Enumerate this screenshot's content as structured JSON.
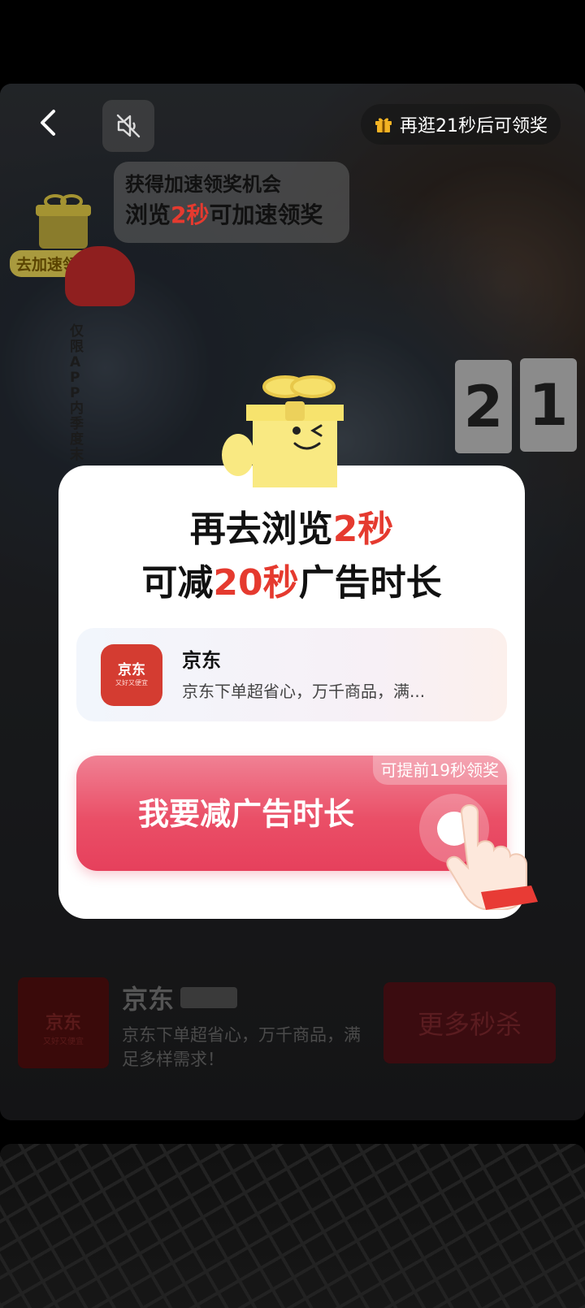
{
  "top_bar": {
    "timer_text": "再逛21秒后可领奖"
  },
  "speed_badge": {
    "label": "去加速领奖"
  },
  "speed_bubble": {
    "line1": "获得加速领奖机会",
    "line2_prefix": "浏览",
    "line2_highlight": "2秒",
    "line2_suffix": "可加速领奖"
  },
  "background_text": {
    "vertical_note": "仅限APP内季度末",
    "date_digits": [
      "2",
      "1"
    ]
  },
  "modal": {
    "title_line1_prefix": "再去浏览",
    "title_line1_highlight": "2秒",
    "title_line2_prefix": "可减",
    "title_line2_highlight": "20秒",
    "title_line2_suffix": "广告时长",
    "app": {
      "icon_logo": "京东",
      "icon_slogan": "又好又便宜",
      "name": "京东",
      "description": "京东下单超省心，万千商品，满..."
    },
    "cta_chip": "可提前19秒领奖",
    "cta_label": "我要减广告时长"
  },
  "bottom_ad": {
    "logo_text": "京东",
    "logo_slogan": "又好又便宜",
    "name": "京东",
    "description": "京东下单超省心，万千商品，满足多样需求！",
    "cta_label": "更多秒杀"
  },
  "colors": {
    "accent_red": "#e53a2f",
    "cta_pink": "#ea4f67",
    "brand_red": "#d43c31"
  }
}
